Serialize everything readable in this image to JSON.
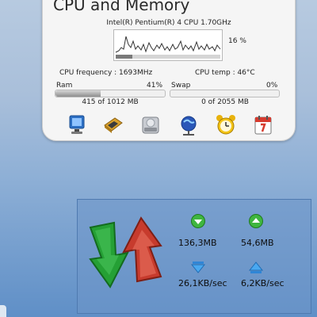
{
  "cpu_widget": {
    "title": "CPU and Memory",
    "cpu_model": "Intel(R) Pentium(R) 4 CPU 1.70GHz",
    "cpu_usage_percent": 16,
    "cpu_usage_label": "16 %",
    "cpu_frequency": "CPU frequency : 1693MHz",
    "cpu_temp": "CPU temp : 46°C",
    "ram": {
      "label": "Ram",
      "percent_label": "41%",
      "percent": 41,
      "amount": "415 of 1012 MB"
    },
    "swap": {
      "label": "Swap",
      "percent_label": "0%",
      "percent": 0,
      "amount": "0 of 2055 MB"
    },
    "icons": [
      "monitor-icon",
      "memory-chip-icon",
      "hard-drive-icon",
      "globe-network-icon",
      "alarm-clock-icon",
      "calendar-icon"
    ],
    "colors": {
      "panel": "#f5f5f5",
      "graph_line": "#333333"
    }
  },
  "network_widget": {
    "total_down": "136,3MB",
    "total_up": "54,6MB",
    "rate_down": "26,1KB/sec",
    "rate_up": "6,2KB/sec",
    "icons": [
      "network-transfer-icon",
      "download-total-icon",
      "upload-total-icon",
      "download-rate-icon",
      "upload-rate-icon"
    ],
    "colors": {
      "green": "#2aa52a",
      "red": "#c0392b",
      "blue": "#3a8fd8"
    }
  }
}
